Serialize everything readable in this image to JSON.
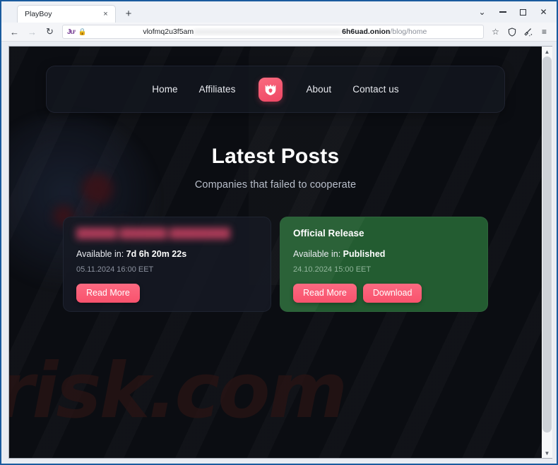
{
  "browser": {
    "tab": {
      "title": "PlayBoy",
      "close_label": "×"
    },
    "newtab_label": "+",
    "window_controls": {
      "list_tabs": "⌄",
      "minimize": "",
      "maximize": "",
      "close": "✕"
    },
    "nav": {
      "back": "←",
      "forward": "→",
      "reload": "↻"
    },
    "url": {
      "tor_glyph": "Ɉư",
      "lock_glyph": "🔒",
      "prefix": "vlofmq2u3f5am",
      "redacted": "xxxxxxxxxxxxxxxxxxxxxxxxxxxxxxxxxxxxxxxx",
      "host": "6h6uad.onion",
      "path": "/blog/home"
    },
    "toolbar": {
      "bookmark": "☆",
      "shield": "⬡",
      "new_identity": "✦",
      "menu": "≡"
    },
    "scrollbar": {
      "up": "▲",
      "down": "▼"
    }
  },
  "site": {
    "watermark": "risk.com",
    "nav": {
      "links_left": [
        {
          "label": "Home"
        },
        {
          "label": "Affiliates"
        }
      ],
      "links_right": [
        {
          "label": "About"
        },
        {
          "label": "Contact us"
        }
      ],
      "logo_name": "playboy-logo"
    },
    "hero": {
      "title": "Latest Posts",
      "subtitle": "Companies that failed to cooperate"
    },
    "posts": [
      {
        "title": "██████ ███████ █████████",
        "redacted": true,
        "available_label": "Available in:",
        "available_value": "7d 6h 20m 22s",
        "date": "05.11.2024 16:00 EET",
        "buttons": [
          {
            "label": "Read More"
          }
        ],
        "variant": "dark"
      },
      {
        "title": "Official Release",
        "redacted": false,
        "available_label": "Available in:",
        "available_value": "Published",
        "date": "24.10.2024 15:00 EET",
        "buttons": [
          {
            "label": "Read More"
          },
          {
            "label": "Download"
          }
        ],
        "variant": "green"
      }
    ]
  },
  "colors": {
    "accent_pink": "#f9526d",
    "card_green": "#235c31",
    "page_bg": "#0b0d12",
    "chrome_border": "#1a5b9e"
  }
}
